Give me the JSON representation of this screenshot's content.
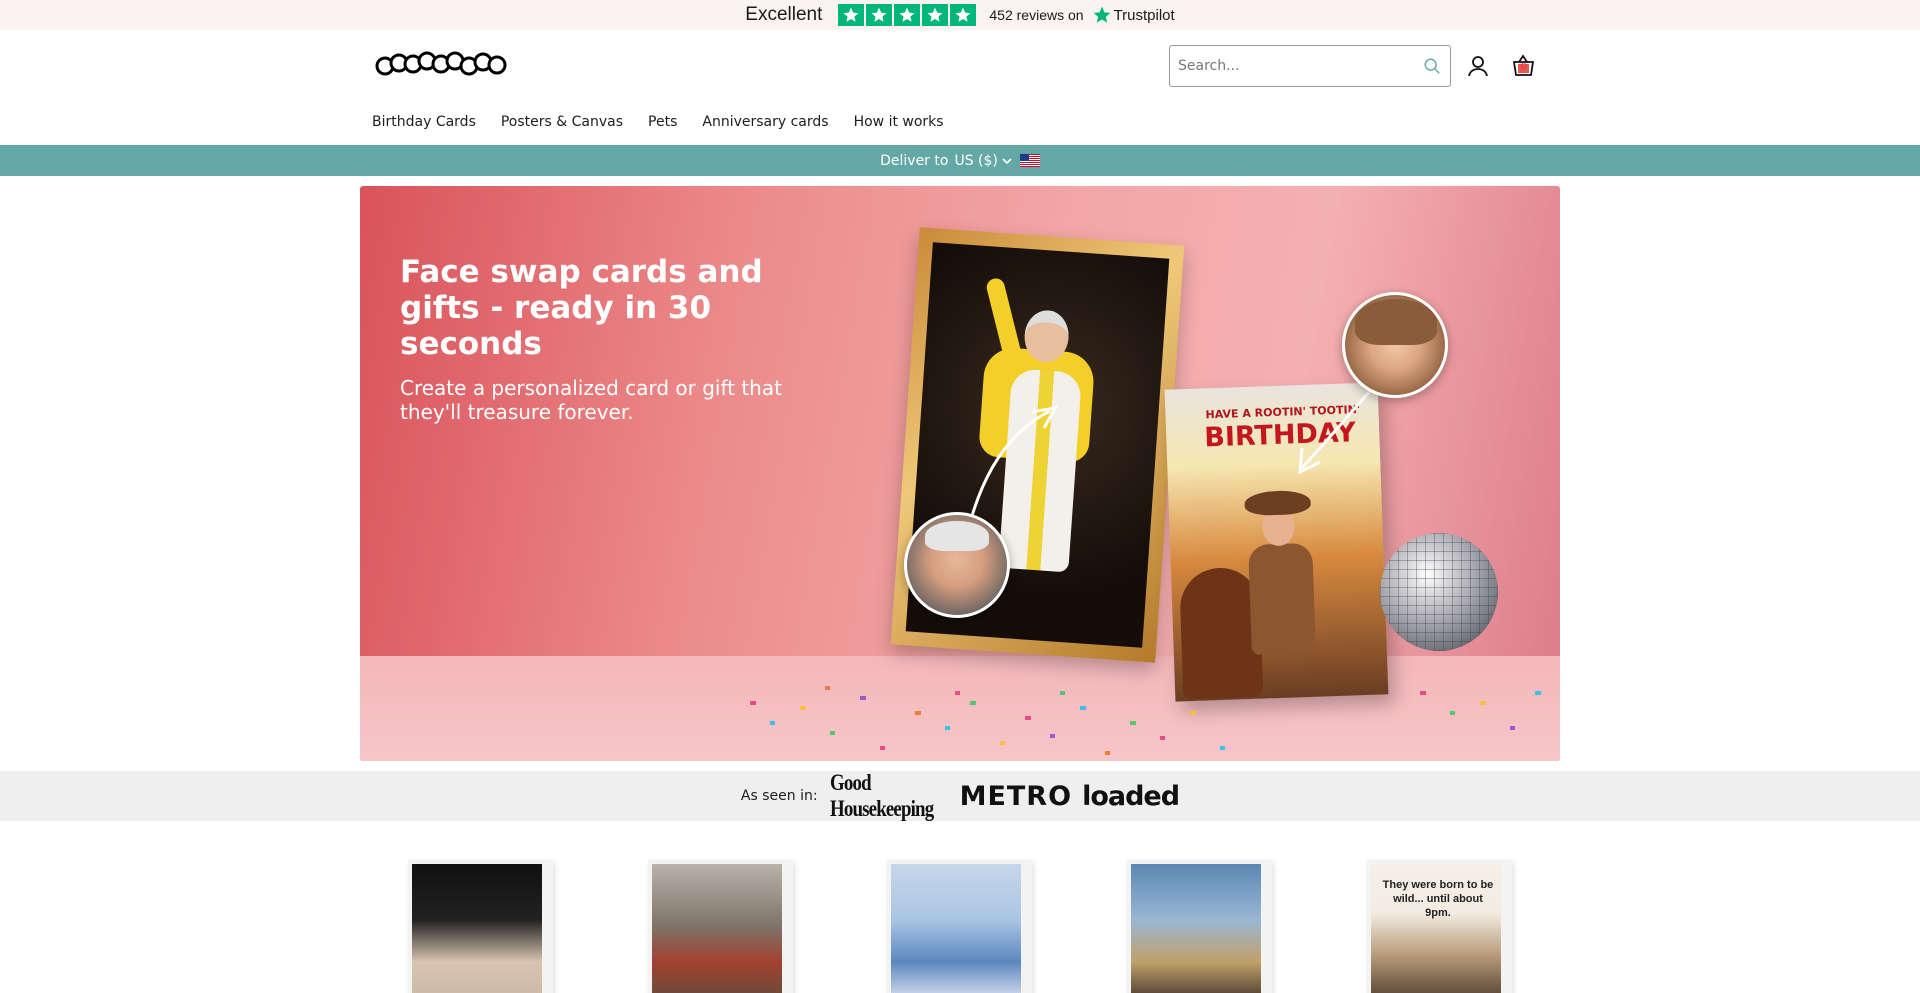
{
  "trustpilot": {
    "rating_word": "Excellent",
    "stars": 5,
    "reviews_text": "452 reviews on",
    "brand": "Trustpilot",
    "star_color": "#00b67a"
  },
  "header": {
    "logo_alt": "Fookanies",
    "search_placeholder": "Search...",
    "cart_count": "0"
  },
  "nav": {
    "items": [
      {
        "label": "Birthday Cards"
      },
      {
        "label": "Posters & Canvas"
      },
      {
        "label": "Pets"
      },
      {
        "label": "Anniversary cards"
      },
      {
        "label": "How it works"
      }
    ]
  },
  "deliver": {
    "label": "Deliver to",
    "value": "US ($)",
    "color": "#64a8a6"
  },
  "hero": {
    "title": "Face swap cards and gifts - ready in 30 seconds",
    "subtitle": "Create a personalized card or gift that they'll treasure forever.",
    "card_line1": "HAVE A ROOTIN' TOOTIN'",
    "card_line2": "BIRTHDAY"
  },
  "seen_in": {
    "label": "As seen in:",
    "outlets": [
      "Good Housekeeping",
      "METRO",
      "loaded"
    ]
  },
  "products": {
    "items": [
      {
        "name": "product-1"
      },
      {
        "name": "product-2"
      },
      {
        "name": "product-3"
      },
      {
        "name": "product-4"
      },
      {
        "name": "product-5",
        "text": "They were born to be wild... until about 9pm."
      }
    ]
  }
}
